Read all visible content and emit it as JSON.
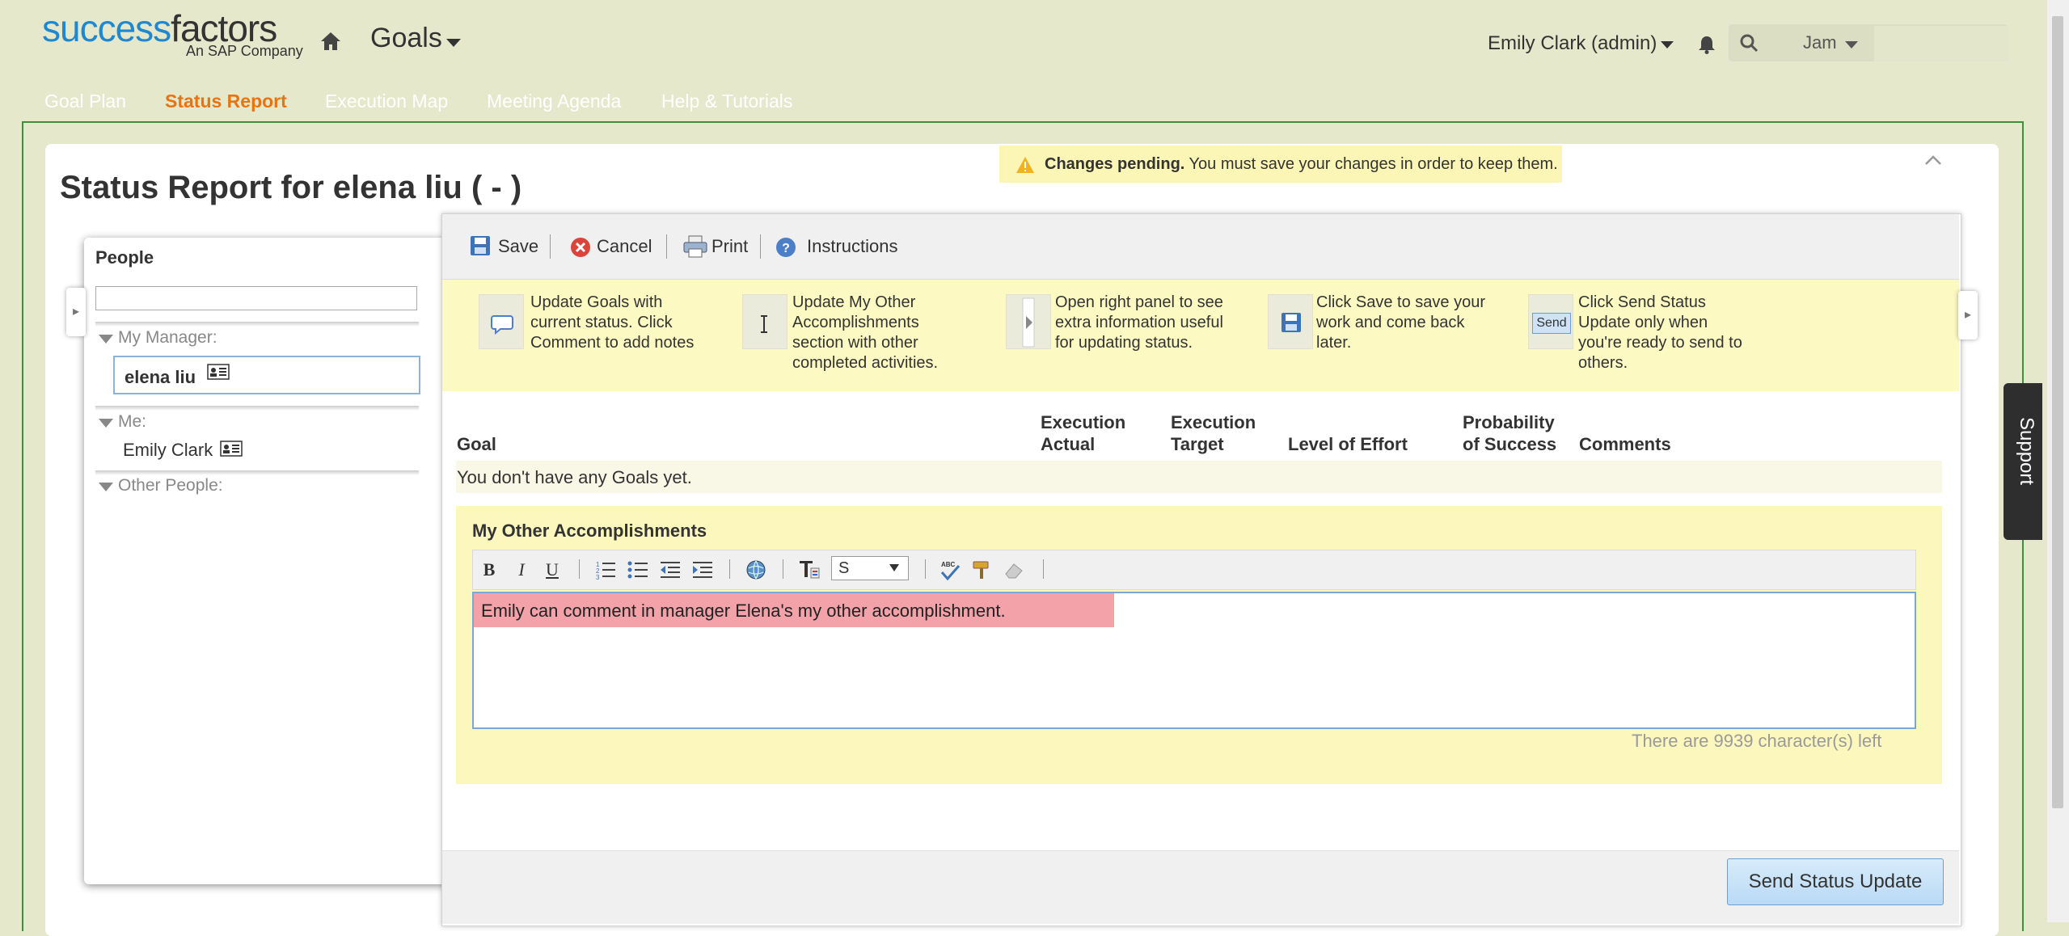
{
  "header": {
    "logo_part1": "success",
    "logo_part2": "factors",
    "logo_sub": "An SAP Company",
    "app_title": "Goals",
    "user_menu": "Emily Clark (admin)",
    "search_scope": "Jam"
  },
  "tabs": [
    {
      "label": "Goal Plan",
      "active": false
    },
    {
      "label": "Status Report",
      "active": true
    },
    {
      "label": "Execution Map",
      "active": false
    },
    {
      "label": "Meeting Agenda",
      "active": false
    },
    {
      "label": "Help & Tutorials",
      "active": false
    }
  ],
  "page": {
    "title": "Status Report for elena liu ( - )",
    "pending_bold": "Changes pending.",
    "pending_text": " You must save your changes in order to keep them."
  },
  "people": {
    "title": "People",
    "groups": {
      "manager_label": "My Manager:",
      "manager_name": "elena liu",
      "me_label": "Me:",
      "me_name": "Emily Clark",
      "other_label": "Other People:"
    }
  },
  "toolbar": {
    "save": "Save",
    "cancel": "Cancel",
    "print": "Print",
    "instructions": "Instructions"
  },
  "instructions": [
    {
      "text": "Update Goals with current status. Click Comment to add notes",
      "icon": "comment-icon"
    },
    {
      "text": "Update My Other Accomplishments section with other completed activities.",
      "icon": "text-cursor-icon"
    },
    {
      "text": "Open right panel to see extra information useful for updating status.",
      "icon": "right-panel-icon"
    },
    {
      "text": "Click Save to save your work and come back later.",
      "icon": "save-icon"
    },
    {
      "text": "Click Send Status Update only when you're ready to send to others.",
      "icon": "send-icon",
      "icon_label": "Send"
    }
  ],
  "columns": {
    "goal": "Goal",
    "execution_actual_1": "Execution",
    "execution_actual_2": "Actual",
    "execution_target_1": "Execution",
    "execution_target_2": "Target",
    "level_of_effort": "Level of Effort",
    "probability_1": "Probability",
    "probability_2": "of Success",
    "comments": "Comments"
  },
  "goals_empty": "You don't have any Goals yet.",
  "accomplishments": {
    "title": "My Other Accomplishments",
    "font_size_value": "S",
    "content": "Emily can comment in manager Elena's my other accomplishment.",
    "chars_left": "There are 9939 character(s) left"
  },
  "footer": {
    "send_button": "Send Status Update"
  },
  "support_tab": "Support",
  "colors": {
    "brand_blue": "#1e88d0",
    "active_tab": "#e8740f",
    "instruction_bg": "#fcfac2",
    "highlight": "#f2a2a8"
  }
}
